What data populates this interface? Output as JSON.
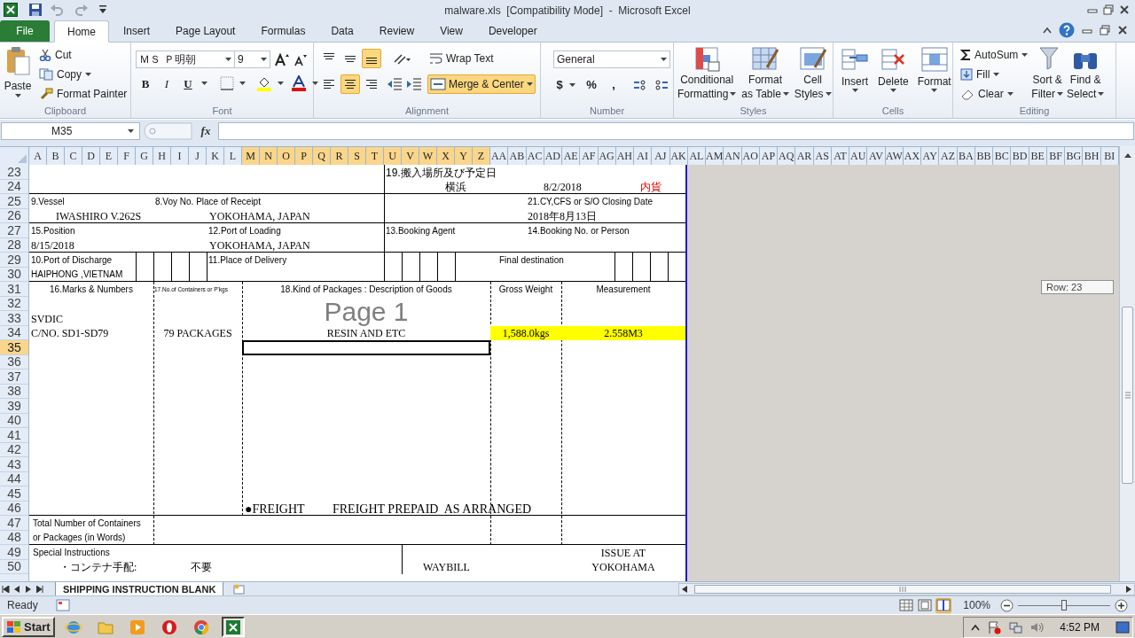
{
  "window": {
    "title": "malware.xls  [Compatibility Mode]  -  Microsoft Excel"
  },
  "tabs": [
    {
      "label": "File",
      "kind": "file",
      "selected": false
    },
    {
      "label": "Home",
      "kind": "tab",
      "selected": true
    },
    {
      "label": "Insert",
      "kind": "tab",
      "selected": false
    },
    {
      "label": "Page Layout",
      "kind": "tab",
      "selected": false
    },
    {
      "label": "Formulas",
      "kind": "tab",
      "selected": false
    },
    {
      "label": "Data",
      "kind": "tab",
      "selected": false
    },
    {
      "label": "Review",
      "kind": "tab",
      "selected": false
    },
    {
      "label": "View",
      "kind": "tab",
      "selected": false
    },
    {
      "label": "Developer",
      "kind": "tab",
      "selected": false
    }
  ],
  "ribbon": {
    "clipboard": {
      "title": "Clipboard",
      "paste": "Paste",
      "cut": "Cut",
      "copy": "Copy",
      "format_painter": "Format Painter"
    },
    "font": {
      "title": "Font",
      "font_name": "ＭＳ Ｐ明朝",
      "font_size": "9",
      "bold": "B",
      "italic": "I",
      "underline": "U"
    },
    "alignment": {
      "title": "Alignment",
      "wrap_text": "Wrap Text",
      "merge_center": "Merge & Center",
      "merge_selected": true,
      "vertical": [
        {
          "kind": "top",
          "selected": false
        },
        {
          "kind": "middle",
          "selected": false
        },
        {
          "kind": "bottom",
          "selected": true
        }
      ],
      "horizontal": [
        {
          "kind": "left",
          "selected": false
        },
        {
          "kind": "center",
          "selected": true
        },
        {
          "kind": "right",
          "selected": false
        }
      ]
    },
    "number": {
      "title": "Number",
      "format": "General",
      "currency": "$",
      "percent": "%",
      "comma": ","
    },
    "styles": {
      "title": "Styles",
      "buttons": [
        {
          "lines": [
            "Conditional",
            "Formatting"
          ],
          "kind": "conditional"
        },
        {
          "lines": [
            "Format",
            "as Table"
          ],
          "kind": "table"
        },
        {
          "lines": [
            "Cell",
            "Styles"
          ],
          "kind": "cellstyles"
        }
      ]
    },
    "cells": {
      "title": "Cells",
      "buttons": [
        {
          "label": "Insert",
          "kind": "insert"
        },
        {
          "label": "Delete",
          "kind": "delete"
        },
        {
          "label": "Format",
          "kind": "format"
        }
      ]
    },
    "editing": {
      "title": "Editing",
      "autosum": "AutoSum",
      "fill": "Fill",
      "clear": "Clear",
      "sort": [
        "Sort &",
        "Filter"
      ],
      "find": [
        "Find &",
        "Select"
      ]
    }
  },
  "formula_bar": {
    "name_box": "M35",
    "function_label": "fx"
  },
  "columns": [
    {
      "label": "A",
      "selected": false
    },
    {
      "label": "B",
      "selected": false
    },
    {
      "label": "C",
      "selected": false
    },
    {
      "label": "D",
      "selected": false
    },
    {
      "label": "E",
      "selected": false
    },
    {
      "label": "F",
      "selected": false
    },
    {
      "label": "G",
      "selected": false
    },
    {
      "label": "H",
      "selected": false
    },
    {
      "label": "I",
      "selected": false
    },
    {
      "label": "J",
      "selected": false
    },
    {
      "label": "K",
      "selected": false
    },
    {
      "label": "L",
      "selected": false
    },
    {
      "label": "M",
      "selected": true
    },
    {
      "label": "N",
      "selected": true
    },
    {
      "label": "O",
      "selected": true
    },
    {
      "label": "P",
      "selected": true
    },
    {
      "label": "Q",
      "selected": true
    },
    {
      "label": "R",
      "selected": true
    },
    {
      "label": "S",
      "selected": true
    },
    {
      "label": "T",
      "selected": true
    },
    {
      "label": "U",
      "selected": true
    },
    {
      "label": "V",
      "selected": true
    },
    {
      "label": "W",
      "selected": true
    },
    {
      "label": "X",
      "selected": true
    },
    {
      "label": "Y",
      "selected": true
    },
    {
      "label": "Z",
      "selected": true
    },
    {
      "label": "AA",
      "selected": false
    },
    {
      "label": "AB",
      "selected": false
    },
    {
      "label": "AC",
      "selected": false
    },
    {
      "label": "AD",
      "selected": false
    },
    {
      "label": "AE",
      "selected": false
    },
    {
      "label": "AF",
      "selected": false
    },
    {
      "label": "AG",
      "selected": false
    },
    {
      "label": "AH",
      "selected": false
    },
    {
      "label": "AI",
      "selected": false
    },
    {
      "label": "AJ",
      "selected": false
    },
    {
      "label": "AK",
      "selected": false
    },
    {
      "label": "AL",
      "selected": false
    },
    {
      "label": "AM",
      "selected": false
    },
    {
      "label": "AN",
      "selected": false
    },
    {
      "label": "AO",
      "selected": false
    },
    {
      "label": "AP",
      "selected": false
    },
    {
      "label": "AQ",
      "selected": false
    },
    {
      "label": "AR",
      "selected": false
    },
    {
      "label": "AS",
      "selected": false
    },
    {
      "label": "AT",
      "selected": false
    },
    {
      "label": "AU",
      "selected": false
    },
    {
      "label": "AV",
      "selected": false
    },
    {
      "label": "AW",
      "selected": false
    },
    {
      "label": "AX",
      "selected": false
    },
    {
      "label": "AY",
      "selected": false
    },
    {
      "label": "AZ",
      "selected": false
    },
    {
      "label": "BA",
      "selected": false
    },
    {
      "label": "BB",
      "selected": false
    },
    {
      "label": "BC",
      "selected": false
    },
    {
      "label": "BD",
      "selected": false
    },
    {
      "label": "BE",
      "selected": false
    },
    {
      "label": "BF",
      "selected": false
    },
    {
      "label": "BG",
      "selected": false
    },
    {
      "label": "BH",
      "selected": false
    },
    {
      "label": "BI",
      "selected": false
    }
  ],
  "rows": [
    {
      "label": "23",
      "selected": false
    },
    {
      "label": "24",
      "selected": false
    },
    {
      "label": "25",
      "selected": false
    },
    {
      "label": "26",
      "selected": false
    },
    {
      "label": "27",
      "selected": false
    },
    {
      "label": "28",
      "selected": false
    },
    {
      "label": "29",
      "selected": false
    },
    {
      "label": "30",
      "selected": false
    },
    {
      "label": "31",
      "selected": false
    },
    {
      "label": "32",
      "selected": false
    },
    {
      "label": "33",
      "selected": false
    },
    {
      "label": "34",
      "selected": false
    },
    {
      "label": "35",
      "selected": true
    },
    {
      "label": "36",
      "selected": false
    },
    {
      "label": "37",
      "selected": false
    },
    {
      "label": "38",
      "selected": false
    },
    {
      "label": "39",
      "selected": false
    },
    {
      "label": "40",
      "selected": false
    },
    {
      "label": "41",
      "selected": false
    },
    {
      "label": "42",
      "selected": false
    },
    {
      "label": "43",
      "selected": false
    },
    {
      "label": "44",
      "selected": false
    },
    {
      "label": "45",
      "selected": false
    },
    {
      "label": "46",
      "selected": false
    },
    {
      "label": "47",
      "selected": false
    },
    {
      "label": "48",
      "selected": false
    },
    {
      "label": "49",
      "selected": false
    },
    {
      "label": "50",
      "selected": false
    }
  ],
  "form": {
    "page_label": "Page 1",
    "cells": [
      {
        "text": "19.搬入場所及び予定日",
        "kind": "heading"
      },
      {
        "text": "横浜",
        "kind": "value"
      },
      {
        "text": "8/2/2018",
        "kind": "value"
      },
      {
        "text": "内貨",
        "kind": "alert"
      },
      {
        "text": "9.Vessel",
        "kind": "label"
      },
      {
        "text": "8.Voy No. Place of Receipt",
        "kind": "label"
      },
      {
        "text": "21.CY,CFS or S/O Closing Date",
        "kind": "label"
      },
      {
        "text": "IWASHIRO V.262S",
        "kind": "value"
      },
      {
        "text": "YOKOHAMA, JAPAN",
        "kind": "value"
      },
      {
        "text": "2018年8月13日",
        "kind": "value"
      },
      {
        "text": "15.Position",
        "kind": "label"
      },
      {
        "text": "12.Port of Loading",
        "kind": "label"
      },
      {
        "text": "13.Booking Agent",
        "kind": "label"
      },
      {
        "text": "14.Booking No. or Person",
        "kind": "label"
      },
      {
        "text": "8/15/2018",
        "kind": "value"
      },
      {
        "text": "YOKOHAMA, JAPAN",
        "kind": "value"
      },
      {
        "text": "10.Port of Discharge",
        "kind": "label"
      },
      {
        "text": "11.Place of Delivery",
        "kind": "label"
      },
      {
        "text": "Final destination",
        "kind": "label"
      },
      {
        "text": "HAIPHONG ,VIETNAM",
        "kind": "label"
      },
      {
        "text": "16.Marks & Numbers",
        "kind": "label"
      },
      {
        "text": "17.No.of Containers or P'kgs",
        "kind": "tiny"
      },
      {
        "text": "18.Kind of Packages : Description of Goods",
        "kind": "label"
      },
      {
        "text": "Gross Weight",
        "kind": "label"
      },
      {
        "text": "Measurement",
        "kind": "label"
      },
      {
        "text": "SVDIC",
        "kind": "value"
      },
      {
        "text": "C/NO. SD1-SD79",
        "kind": "value"
      },
      {
        "text": "79 PACKAGES",
        "kind": "value"
      },
      {
        "text": "RESIN AND ETC",
        "kind": "value"
      },
      {
        "text": "1,588.0kgs",
        "kind": "highlight"
      },
      {
        "text": "2.558M3",
        "kind": "highlight"
      },
      {
        "text": "●FREIGHT",
        "kind": "big"
      },
      {
        "text": "FREIGHT PREPAID  AS ARRANGED",
        "kind": "big"
      },
      {
        "text": "Total Number of Containers",
        "kind": "label"
      },
      {
        "text": "or Packages (in Words)",
        "kind": "label"
      },
      {
        "text": "Special Instructions",
        "kind": "label"
      },
      {
        "text": "・コンテナ手配:",
        "kind": "value"
      },
      {
        "text": "不要",
        "kind": "value"
      },
      {
        "text": "WAYBILL",
        "kind": "value"
      },
      {
        "text": "ISSUE AT",
        "kind": "value"
      },
      {
        "text": "YOKOHAMA",
        "kind": "value"
      }
    ]
  },
  "tooltip": "Row: 23",
  "sheet_tabs": [
    {
      "label": "SHIPPING INSTRUCTION BLANK",
      "selected": true
    }
  ],
  "status_bar": {
    "mode": "Ready",
    "zoom": "100%",
    "zoom_level": {
      "level": 0.5
    },
    "views": [
      {
        "kind": "normal",
        "selected": false
      },
      {
        "kind": "layout",
        "selected": false
      },
      {
        "kind": "pagebreak",
        "selected": true
      }
    ]
  },
  "taskbar": {
    "start": "Start",
    "time": "4:52 PM",
    "apps": [
      {
        "kind": "ie",
        "selected": false
      },
      {
        "kind": "folder",
        "selected": false
      },
      {
        "kind": "media",
        "selected": false
      },
      {
        "kind": "opera",
        "selected": false
      },
      {
        "kind": "chrome",
        "selected": false
      },
      {
        "kind": "excel",
        "selected": true
      }
    ]
  }
}
